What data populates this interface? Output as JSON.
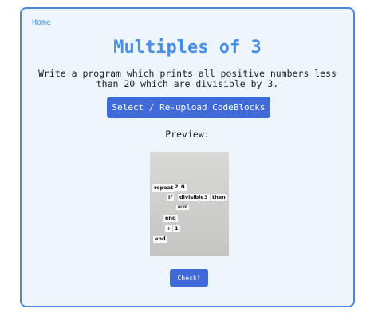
{
  "nav": {
    "home_label": "Home"
  },
  "page": {
    "title": "Multiples of 3",
    "description": "Write a program which prints all positive numbers less than 20 which are divisible by 3.",
    "upload_button_label": "Select / Re-upload CodeBlocks",
    "preview_label": "Preview:",
    "check_button_label": "Check!"
  },
  "preview": {
    "blocks": {
      "repeat": "repeat",
      "num_2": "2",
      "num_0": "0",
      "if": "if",
      "divisible": "divisible",
      "num_3": "3",
      "then": "then",
      "print": "print",
      "end_inner": "end",
      "plus": "+",
      "num_1": "1",
      "end_outer": "end"
    }
  },
  "colors": {
    "accent": "#4a90e2",
    "button": "#3f6ad8",
    "card_border": "#4a86d8",
    "card_background": "#eef6fd"
  }
}
